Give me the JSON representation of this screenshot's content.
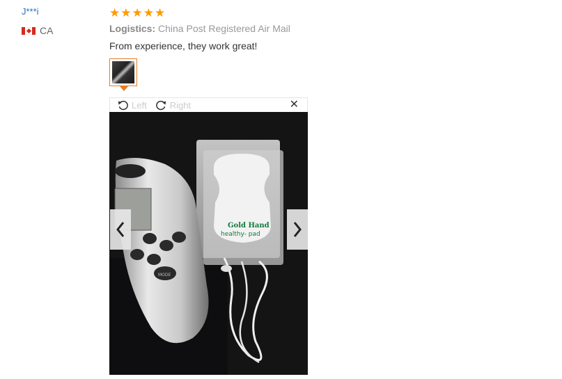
{
  "reviewer": {
    "name": "J***i",
    "country": "CA"
  },
  "review": {
    "rating": 5,
    "stars": [
      "★",
      "★",
      "★",
      "★",
      "★"
    ],
    "logistics_label": "Logistics:",
    "logistics_value": "China Post Registered Air Mail",
    "text": "From experience, they work great!"
  },
  "viewer": {
    "rotate_left_label": "Left",
    "rotate_right_label": "Right",
    "close_symbol": "✕"
  },
  "photo": {
    "pad_text_line1": "Gold Hand",
    "pad_text_line2": "healthy- pad",
    "device_button_label": "MODE"
  },
  "colors": {
    "accent": "#ff9a00",
    "link": "#2a6ebb",
    "thumb_border": "#e67e22"
  }
}
